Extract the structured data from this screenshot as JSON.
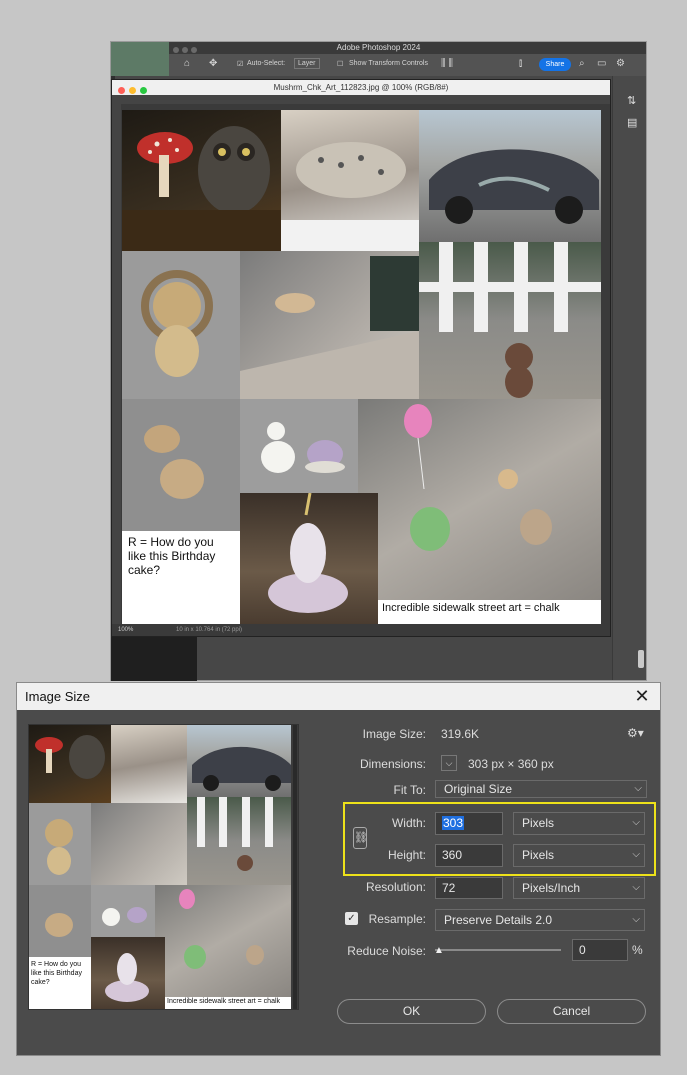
{
  "photoshop": {
    "app_title": "Adobe Photoshop 2024",
    "options_bar": {
      "auto_select_label": "Auto-Select:",
      "auto_select_value": "Layer",
      "transform_label": "Show Transform Controls",
      "share_label": "Share"
    },
    "document": {
      "title": "Mushrm_Chk_Art_112823.jpg @ 100% (RGB/8#)",
      "zoom": "100%",
      "doc_info": "10 in x 10.764 in (72 ppi)"
    },
    "collage": {
      "caption_left": "R  = How do you like this Birthday cake?",
      "caption_right": "Incredible sidewalk street art = chalk"
    }
  },
  "dialog": {
    "title": "Image Size",
    "image_size_label": "Image Size:",
    "image_size_value": "319.6K",
    "dimensions_label": "Dimensions:",
    "dimensions_value": "303 px  ×  360 px",
    "fit_to_label": "Fit To:",
    "fit_to_value": "Original Size",
    "width_label": "Width:",
    "width_value": "303",
    "width_unit": "Pixels",
    "height_label": "Height:",
    "height_value": "360",
    "height_unit": "Pixels",
    "resolution_label": "Resolution:",
    "resolution_value": "72",
    "resolution_unit": "Pixels/Inch",
    "resample_label": "Resample:",
    "resample_checked": true,
    "resample_value": "Preserve Details 2.0",
    "reduce_noise_label": "Reduce Noise:",
    "reduce_noise_value": "0",
    "reduce_noise_unit": "%",
    "ok_label": "OK",
    "cancel_label": "Cancel"
  },
  "colors": {
    "highlight": "#eee21a",
    "share_blue": "#1473e6",
    "dialog_bg": "#4b4b4b"
  }
}
